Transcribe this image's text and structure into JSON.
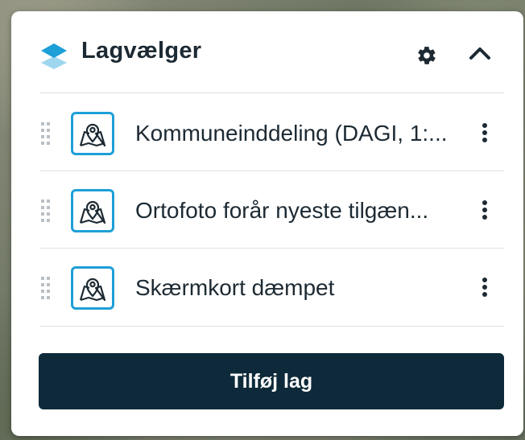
{
  "panel": {
    "title": "Lagvælger",
    "logo_icon": "layers-stack-icon",
    "settings_icon": "gear-icon",
    "collapse_icon": "chevron-up-icon"
  },
  "layers": [
    {
      "label": "Kommuneinddeling (DAGI, 1:...",
      "icon": "map-pin-icon"
    },
    {
      "label": "Ortofoto forår nyeste tilgæn...",
      "icon": "map-pin-icon"
    },
    {
      "label": "Skærmkort dæmpet",
      "icon": "map-pin-icon"
    }
  ],
  "add_button": {
    "label": "Tilføj lag"
  },
  "colors": {
    "accent": "#1e9fd8",
    "button_bg": "#0e2a3a",
    "text": "#1d2a33"
  }
}
